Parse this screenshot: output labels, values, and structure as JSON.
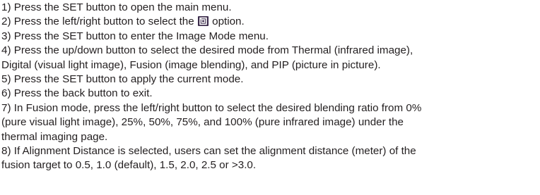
{
  "steps": [
    {
      "lines": [
        "1) Press the SET button to open the main menu."
      ]
    },
    {
      "before_icon": "2) Press the left/right button to select the ",
      "icon": "image-mode-icon",
      "after_icon": " option."
    },
    {
      "lines": [
        "3) Press the SET button to enter the Image Mode menu."
      ]
    },
    {
      "lines": [
        "4) Press the up/down button to select the desired mode from Thermal (infrared image),",
        "Digital (visual light image), Fusion (image blending), and PIP (picture in picture)."
      ]
    },
    {
      "lines": [
        "5) Press the SET button to apply the current mode."
      ]
    },
    {
      "lines": [
        "6) Press the back button to exit."
      ]
    },
    {
      "lines": [
        "7) In Fusion mode, press the left/right button to select the desired blending ratio from 0%",
        "(pure visual light image), 25%, 50%, 75%, and 100% (pure infrared image) under the",
        "thermal imaging page."
      ]
    },
    {
      "lines": [
        "8) If Alignment Distance is selected, users can set the alignment distance (meter) of the",
        "fusion target to 0.5, 1.0 (default), 1.5, 2.0, 2.5 or >3.0."
      ]
    }
  ],
  "colors": {
    "text": "#231f20",
    "icon_bg": "#3a2a4a",
    "icon_fg": "#ffffff"
  }
}
